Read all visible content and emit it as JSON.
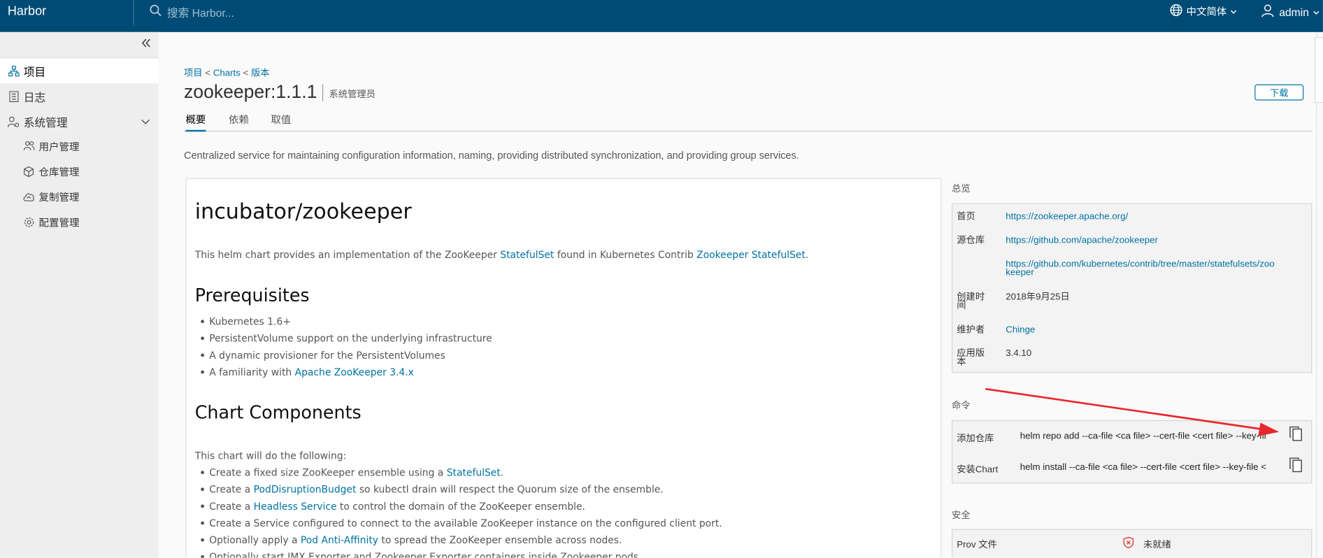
{
  "header": {
    "brand": "Harbor",
    "search_placeholder": "搜索 Harbor...",
    "language": "中文简体",
    "user": "admin"
  },
  "sidebar": {
    "items": [
      {
        "label": "项目",
        "icon": "projects-icon",
        "active": true
      },
      {
        "label": "日志",
        "icon": "logs-icon",
        "active": false
      },
      {
        "label": "系统管理",
        "icon": "admin-icon",
        "active": false
      }
    ],
    "sub_items": [
      {
        "label": "用户管理",
        "icon": "users-icon"
      },
      {
        "label": "仓库管理",
        "icon": "registry-icon"
      },
      {
        "label": "复制管理",
        "icon": "replication-icon"
      },
      {
        "label": "配置管理",
        "icon": "config-icon"
      }
    ]
  },
  "breadcrumb": {
    "items": [
      "项目",
      "Charts",
      "版本"
    ],
    "separator": "<"
  },
  "page": {
    "title": "zookeeper:1.1.1",
    "subtitle": "系统管理员",
    "download_label": "下载",
    "tabs": [
      "概要",
      "依赖",
      "取值"
    ],
    "description": "Centralized service for maintaining configuration information, naming, providing distributed synchronization, and providing group services."
  },
  "readme": {
    "title": "incubator/zookeeper",
    "intro": {
      "pre": "This helm chart provides an implementation of the ZooKeeper ",
      "link1": "StatefulSet",
      "mid": " found in Kubernetes Contrib ",
      "link2": "Zookeeper StatefulSet",
      "post": "."
    },
    "prereq_title": "Prerequisites",
    "prereqs": {
      "item1": "Kubernetes 1.6+",
      "item2": "PersistentVolume support on the underlying infrastructure",
      "item3": "A dynamic provisioner for the PersistentVolumes",
      "item4_pre": "A familiarity with ",
      "item4_link": "Apache ZooKeeper 3.4.x"
    },
    "components_title": "Chart Components",
    "components_intro": "This chart will do the following:",
    "components": {
      "c1_pre": "Create a fixed size ZooKeeper ensemble using a ",
      "c1_link": "StatefulSet",
      "c1_post": ".",
      "c2_pre": "Create a ",
      "c2_link": "PodDisruptionBudget",
      "c2_post": " so kubectl drain will respect the Quorum size of the ensemble.",
      "c3_pre": "Create a ",
      "c3_link": "Headless Service",
      "c3_post": " to control the domain of the ZooKeeper ensemble.",
      "c4": "Create a Service configured to connect to the available ZooKeeper instance on the configured client port.",
      "c5_pre": "Optionally apply a ",
      "c5_link": "Pod Anti-Affinity",
      "c5_post": " to spread the ZooKeeper ensemble across nodes.",
      "c6": "Optionally start JMX Exporter and Zookeeper Exporter containers inside Zookeeper pods."
    }
  },
  "overview": {
    "title": "总览",
    "home_label": "首页",
    "home_value": "https://zookeeper.apache.org/",
    "source_label": "源仓库",
    "source_value1": "https://github.com/apache/zookeeper",
    "source_value2_line1": "https://github.com/kubernetes/contrib/tree/master/statefulsets/zoo",
    "source_value2_line2": "keeper",
    "created_label_line1": "创建时",
    "created_label_line2": "间",
    "created_value": "2018年9月25日",
    "maintainer_label": "维护者",
    "maintainer_value": "Chinge",
    "app_version_label_line1": "应用版",
    "app_version_label_line2": "本",
    "app_version_value": "3.4.10"
  },
  "commands": {
    "title": "命令",
    "add_repo_label": "添加仓库",
    "add_repo_value": "helm repo add --ca-file <ca file> --cert-file <cert file> --key-file <key file> --username <username> --password <password>",
    "install_label": "安装Chart",
    "install_value": "helm install --ca-file <ca file> --cert-file <cert file> --key-file <key file> --username <username> --password <password>"
  },
  "security": {
    "title": "安全",
    "prov_label": "Prov 文件",
    "prov_status": "未就绪"
  },
  "colors": {
    "header_bg": "#004b75",
    "link": "#0072a3",
    "arrow": "#e8262b",
    "sidebar_bg": "#eeeeee"
  }
}
